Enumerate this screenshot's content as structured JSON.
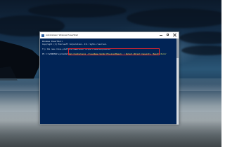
{
  "window": {
    "title": "Administrator: Windows PowerShell",
    "buttons": {
      "minimize_icon": "minimize-icon",
      "maximize_icon": "maximize-icon",
      "close_icon": "close-icon"
    }
  },
  "console": {
    "lines": [
      "Windows PowerShell",
      "Copyright (C) Microsoft Corporation. All rights reserved.",
      "",
      "Try the new cross-platform PowerShell https://aka.ms/pscore6"
    ],
    "prompt": "PS C:\\WINDOWS\\system32>",
    "command": "Get-CimInstance -ClassName Win32_PhysicalMemory | Select-Object Capacity, Manufacturer"
  },
  "colors": {
    "console_background": "#012456",
    "highlight_border": "#e1252f",
    "command_text": "#f4f56a"
  }
}
